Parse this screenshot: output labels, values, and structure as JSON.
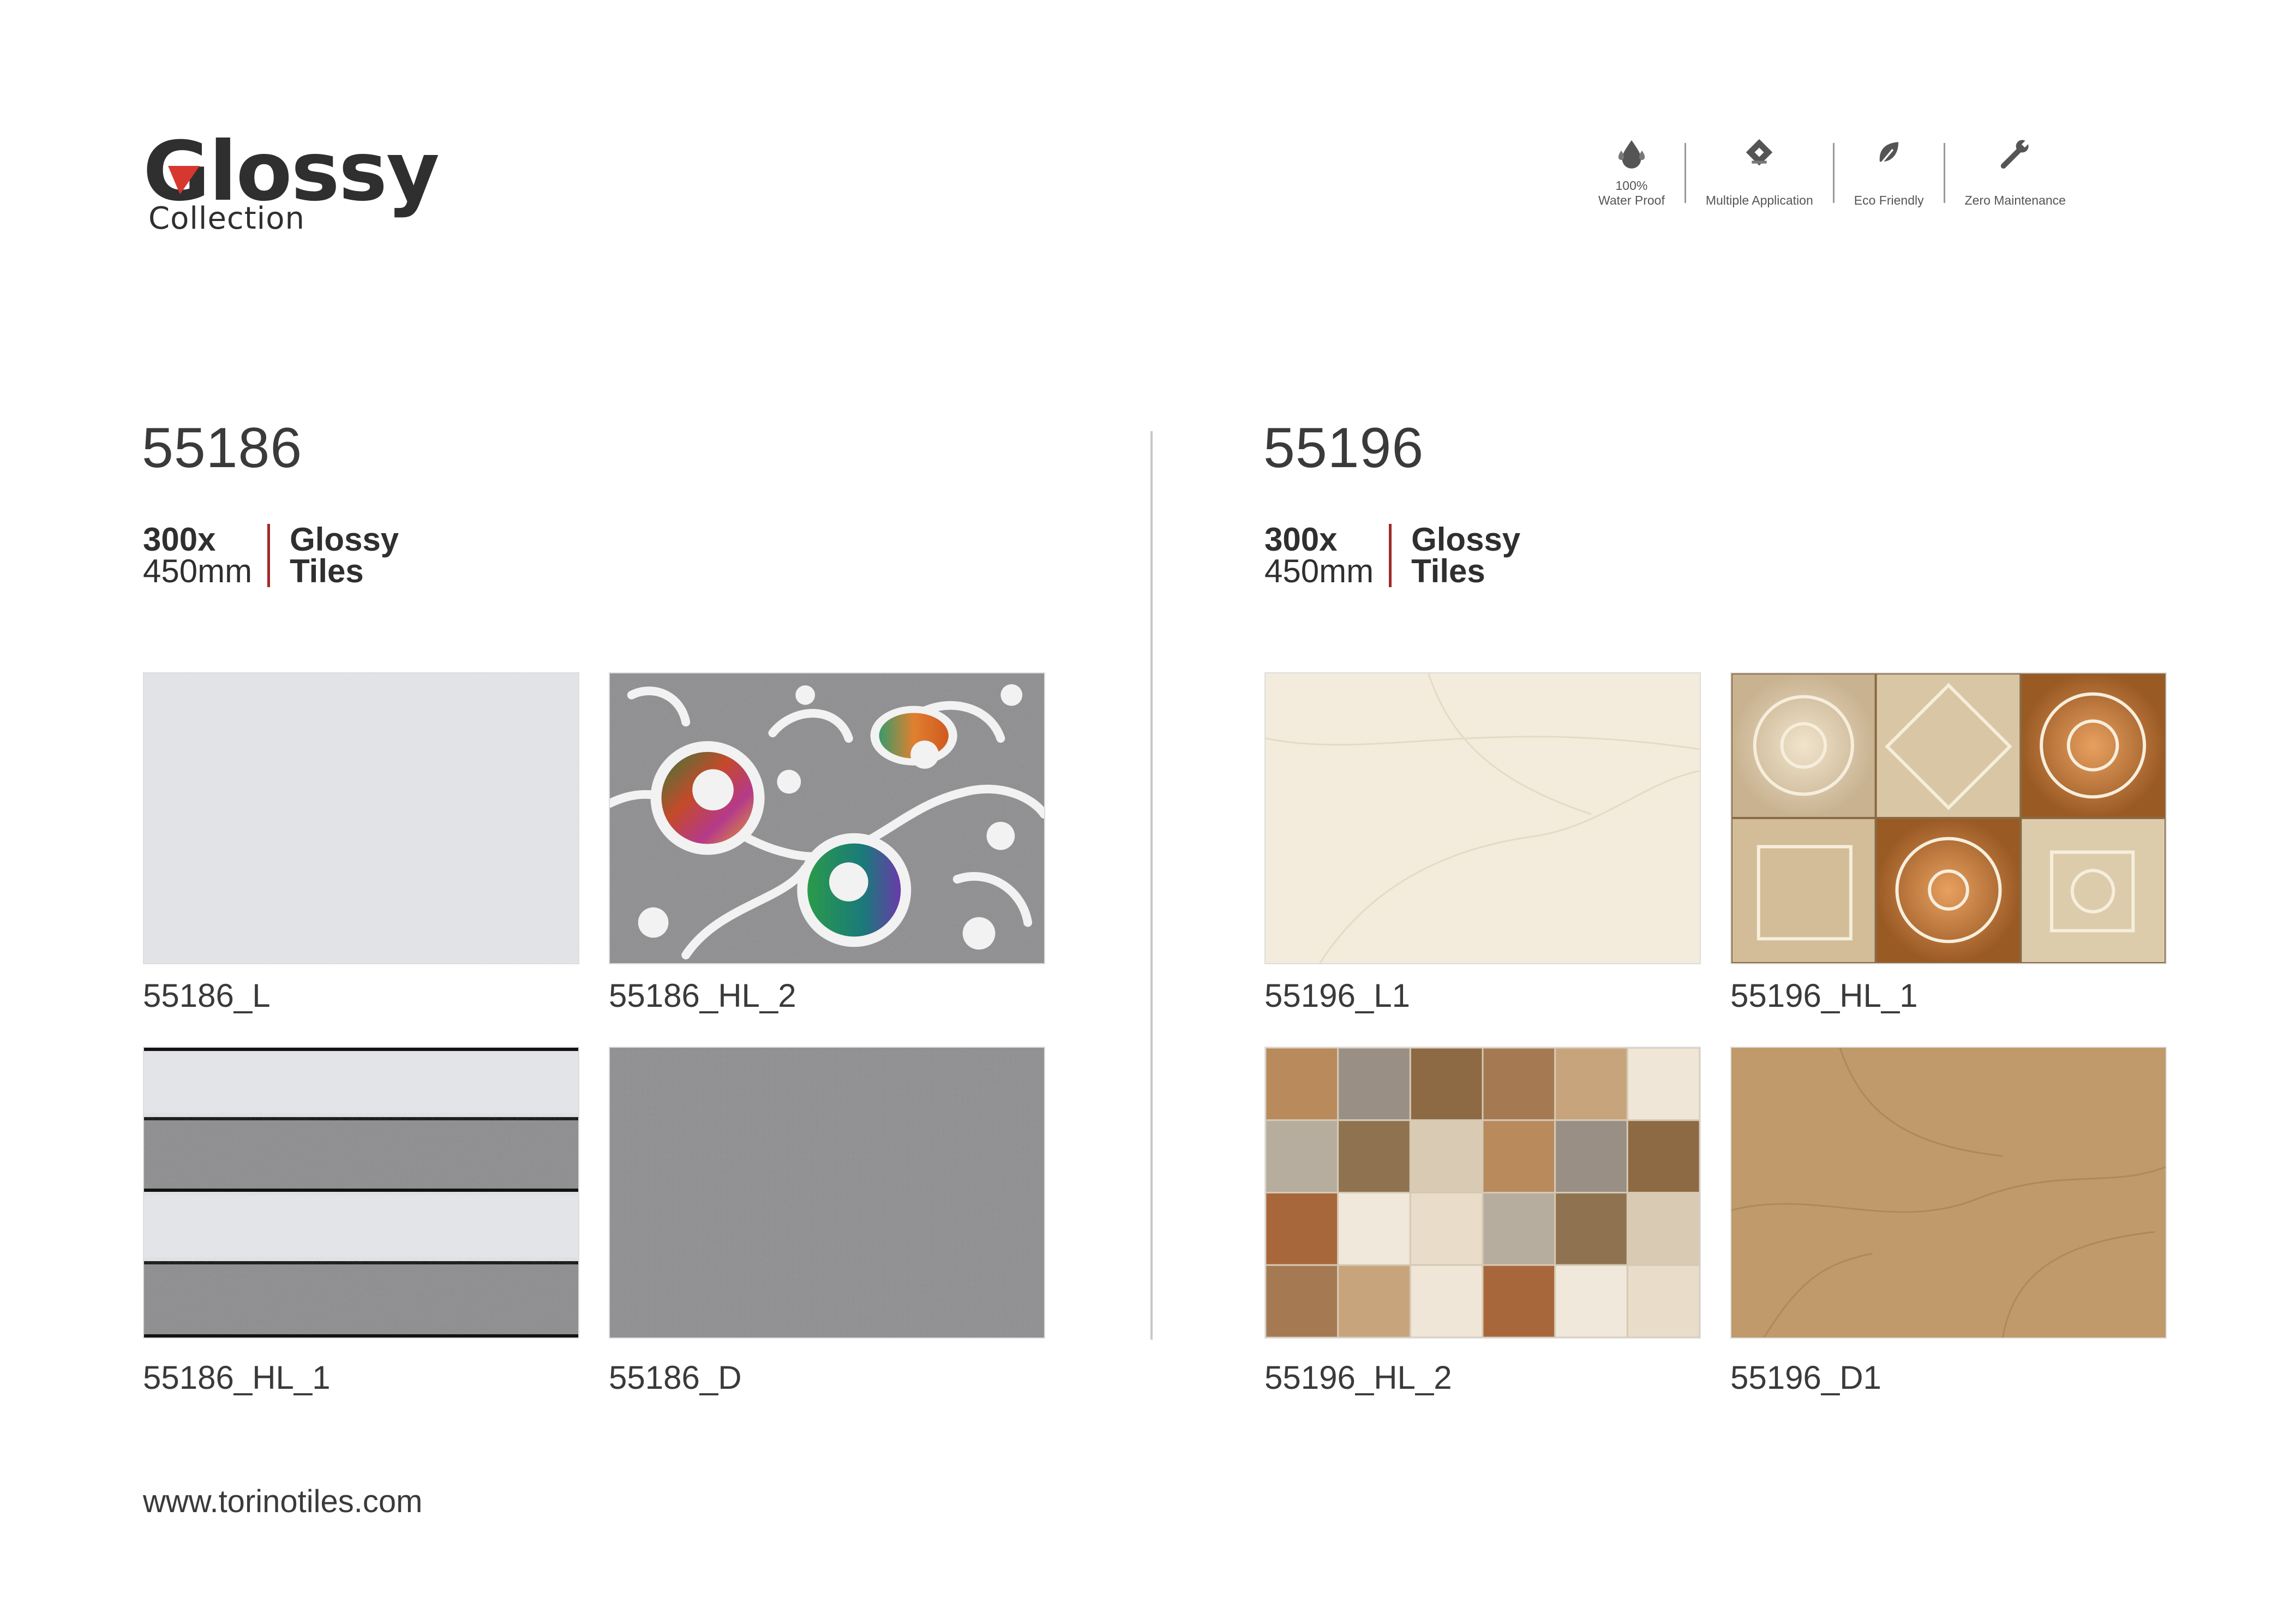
{
  "logo": {
    "title": "Glossy",
    "subtitle": "Collection"
  },
  "features": [
    {
      "icon": "water-drop-icon",
      "label_line1": "100%",
      "label_line2": "Water Proof"
    },
    {
      "icon": "application-tile-icon",
      "label_line1": "",
      "label_line2": "Multiple Application"
    },
    {
      "icon": "leaf-icon",
      "label_line1": "",
      "label_line2": "Eco Friendly"
    },
    {
      "icon": "wrench-icon",
      "label_line1": "",
      "label_line2": "Zero Maintenance"
    }
  ],
  "series": [
    {
      "code": "55186",
      "size_line1": "300x",
      "size_line2": "450mm",
      "type_line1": "Glossy",
      "type_line2": "Tiles",
      "tiles": [
        {
          "label": "55186_L"
        },
        {
          "label": "55186_HL_2"
        },
        {
          "label": "55186_HL_1"
        },
        {
          "label": "55186_D"
        }
      ]
    },
    {
      "code": "55196",
      "size_line1": "300x",
      "size_line2": "450mm",
      "type_line1": "Glossy",
      "type_line2": "Tiles",
      "tiles": [
        {
          "label": "55196_L1"
        },
        {
          "label": "55196_HL_1"
        },
        {
          "label": "55196_HL_2"
        },
        {
          "label": "55196_D1"
        }
      ]
    }
  ],
  "footer": {
    "url": "www.torinotiles.com"
  },
  "colors": {
    "accent": "#a12a2a",
    "text": "#3a3a3a"
  }
}
